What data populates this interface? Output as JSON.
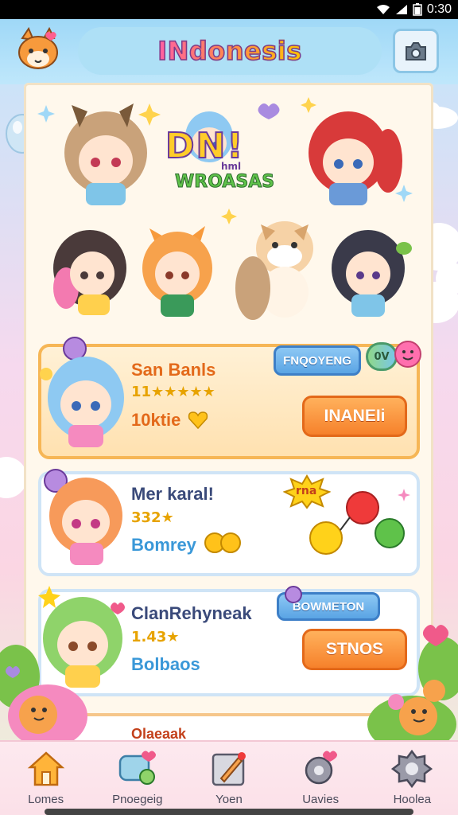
{
  "status_bar": {
    "time": "0:30"
  },
  "header": {
    "title": "INdonesis"
  },
  "banner": {
    "logo_line1": "DN!",
    "logo_line2": "WROASAS",
    "logo_small": "hml"
  },
  "cards": [
    {
      "name": "San Banls",
      "stars_text": "11★★★★★",
      "sub_text": "10ktie",
      "pill_label": "FNQOYENG",
      "badge_text": "0V",
      "button_label": "INANEIi",
      "name_color": "#e3691a",
      "sub_color": "#e3691a"
    },
    {
      "name": "Mer karal!",
      "stars_text": "332★",
      "sub_text": "Bomrey",
      "burst_text": "rna",
      "name_color": "#3a4a7a",
      "sub_color": "#3a98d8"
    },
    {
      "name": "ClanRehyneak",
      "stars_text": "1.43★",
      "sub_text": "Bolbaos",
      "pill_label": "BOWMETON",
      "button_label": "STNOS",
      "name_color": "#3a4a7a",
      "sub_color": "#3a98d8"
    },
    {
      "name": "Olaeaak"
    }
  ],
  "nav": [
    {
      "label": "Lomes",
      "icon": "house-icon"
    },
    {
      "label": "Pnoegeig",
      "icon": "chat-bubble-icon"
    },
    {
      "label": "Yoen",
      "icon": "edit-pencil-icon"
    },
    {
      "label": "Uavies",
      "icon": "settings-gear-icon"
    },
    {
      "label": "Hoolea",
      "icon": "gear-alert-icon"
    }
  ],
  "colors": {
    "accent_orange": "#f6812b",
    "accent_blue": "#5aa4e4",
    "card_border_blue": "#cfe4f6",
    "card_border_orange": "#f6b656"
  }
}
